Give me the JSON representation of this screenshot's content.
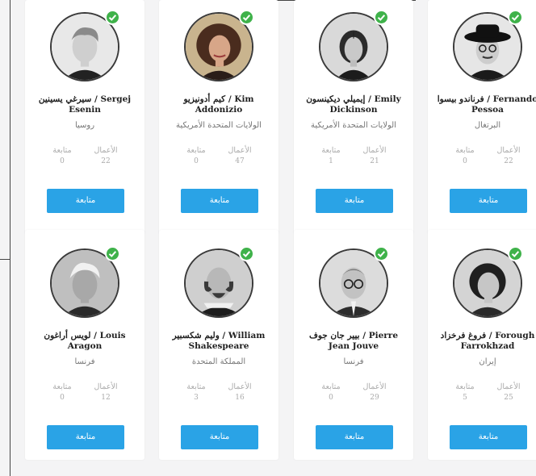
{
  "accent_color": "#2aa3e6",
  "verified_color": "#3fb24a",
  "follow_label": "متابعة",
  "stats_labels": {
    "works": "الأعمال",
    "followers": "متابعة"
  },
  "poets": [
    {
      "name": "سيرغي يسينين / Sergej Esenin",
      "country": "روسيا",
      "works": "22",
      "followers": "0"
    },
    {
      "name": "كيم أدونيزيو / Kim Addonizio",
      "country": "الولايات المتحدة الأمريكية",
      "works": "47",
      "followers": "0"
    },
    {
      "name": "إيميلي ديكينسون / Emily Dickinson",
      "country": "الولايات المتحدة الأمريكية",
      "works": "21",
      "followers": "1"
    },
    {
      "name": "فرناندو بيسوا / Fernando Pessoa",
      "country": "البرتغال",
      "works": "22",
      "followers": "0"
    },
    {
      "name": "لويس أراغون / Louis Aragon",
      "country": "فرنسا",
      "works": "12",
      "followers": "0"
    },
    {
      "name": "وليم شكسبير / William Shakespeare",
      "country": "المملكة المتحدة",
      "works": "16",
      "followers": "3"
    },
    {
      "name": "بيير جان جوف / Pierre Jean Jouve",
      "country": "فرنسا",
      "works": "29",
      "followers": "0"
    },
    {
      "name": "فروغ فرخزاد / Forough Farrokhzad",
      "country": "إيران",
      "works": "25",
      "followers": "5"
    }
  ]
}
